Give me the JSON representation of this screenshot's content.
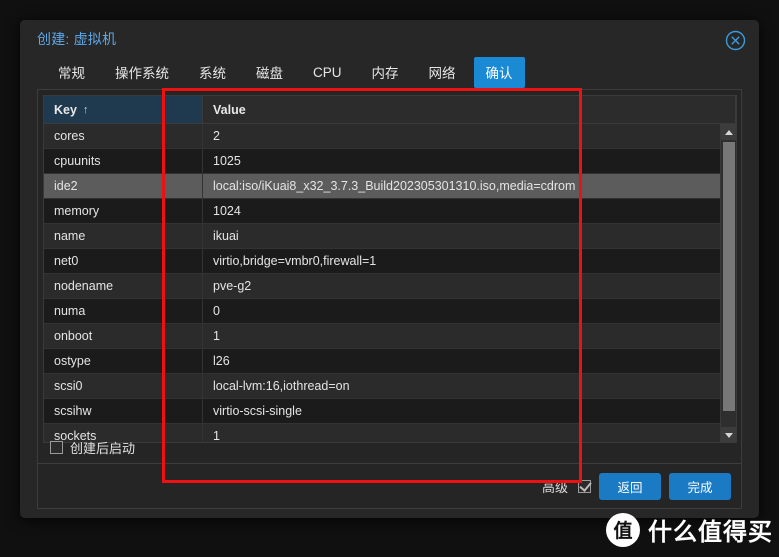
{
  "window": {
    "title": "创建: 虚拟机",
    "close_icon": "close-circle-icon"
  },
  "tabs": [
    {
      "label": "常规",
      "active": false
    },
    {
      "label": "操作系统",
      "active": false
    },
    {
      "label": "系统",
      "active": false
    },
    {
      "label": "磁盘",
      "active": false
    },
    {
      "label": "CPU",
      "active": false
    },
    {
      "label": "内存",
      "active": false
    },
    {
      "label": "网络",
      "active": false
    },
    {
      "label": "确认",
      "active": true
    }
  ],
  "grid": {
    "columns": [
      {
        "label": "Key",
        "sort": "↑"
      },
      {
        "label": "Value",
        "sort": ""
      }
    ],
    "rows": [
      {
        "key": "cores",
        "value": "2"
      },
      {
        "key": "cpuunits",
        "value": "1025"
      },
      {
        "key": "ide2",
        "value": "local:iso/iKuai8_x32_3.7.3_Build202305301310.iso,media=cdrom",
        "selected": true
      },
      {
        "key": "memory",
        "value": "1024"
      },
      {
        "key": "name",
        "value": "ikuai"
      },
      {
        "key": "net0",
        "value": "virtio,bridge=vmbr0,firewall=1"
      },
      {
        "key": "nodename",
        "value": "pve-g2"
      },
      {
        "key": "numa",
        "value": "0"
      },
      {
        "key": "onboot",
        "value": "1"
      },
      {
        "key": "ostype",
        "value": "l26"
      },
      {
        "key": "scsi0",
        "value": "local-lvm:16,iothread=on"
      },
      {
        "key": "scsihw",
        "value": "virtio-scsi-single"
      },
      {
        "key": "sockets",
        "value": "1"
      }
    ],
    "scrollbar": {
      "up_icon": "triangle-up-icon",
      "down_icon": "triangle-down-icon"
    }
  },
  "options": {
    "start_after_create": {
      "label": "创建后启动",
      "checked": false
    }
  },
  "footer": {
    "advanced": {
      "label": "高级",
      "checked": true
    },
    "back_label": "返回",
    "finish_label": "完成"
  },
  "watermark": {
    "logo": "值",
    "text": "什么值得买"
  },
  "colors": {
    "accent": "#1a8ad4",
    "title": "#5ca8e8",
    "annotation": "#ee1111",
    "selected_row": "#5c5c5c",
    "key_header": "#1f394f"
  }
}
